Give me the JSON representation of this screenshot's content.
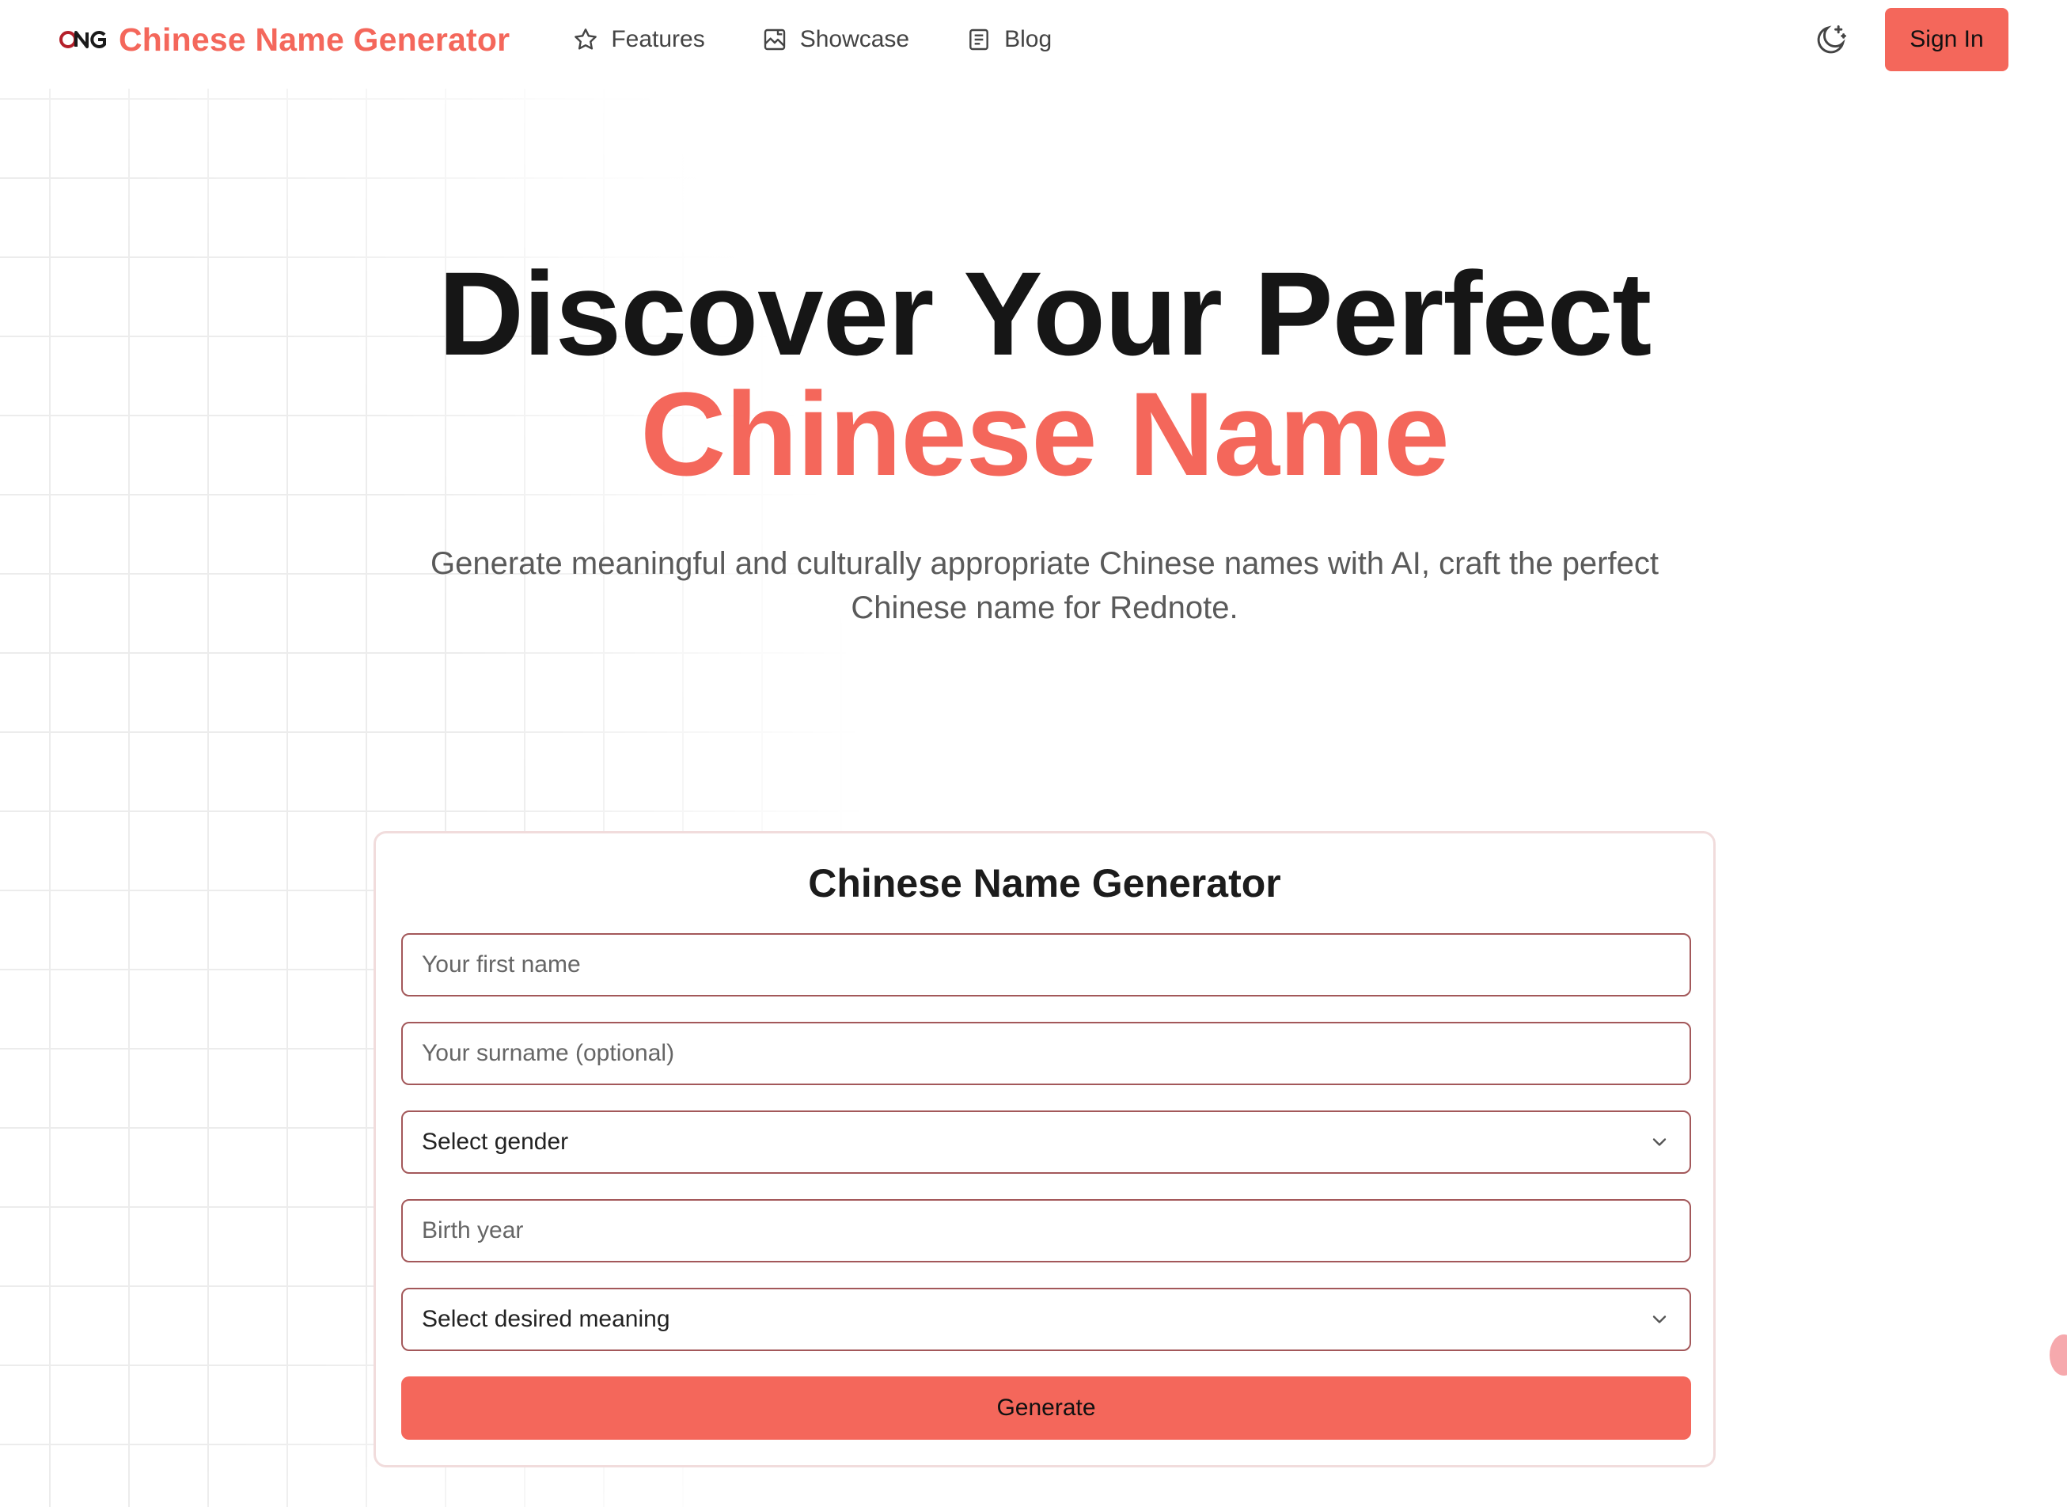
{
  "header": {
    "brand": "Chinese Name Generator",
    "nav": [
      {
        "label": "Features",
        "icon": "star-icon"
      },
      {
        "label": "Showcase",
        "icon": "image-icon"
      },
      {
        "label": "Blog",
        "icon": "document-icon"
      }
    ],
    "theme_icon": "moon-icon",
    "signin_label": "Sign In"
  },
  "hero": {
    "line1": "Discover Your Perfect",
    "line2": "Chinese Name",
    "subtitle": "Generate meaningful and culturally appropriate Chinese names with AI, craft the perfect Chinese name for Rednote."
  },
  "form": {
    "title": "Chinese Name Generator",
    "first_name_placeholder": "Your first name",
    "surname_placeholder": "Your surname (optional)",
    "gender_select": "Select gender",
    "birth_year_placeholder": "Birth year",
    "meaning_select": "Select desired meaning",
    "generate_label": "Generate"
  },
  "colors": {
    "accent": "#f4675b",
    "input_border": "#a3585a",
    "logo_dark": "#b4202a"
  }
}
